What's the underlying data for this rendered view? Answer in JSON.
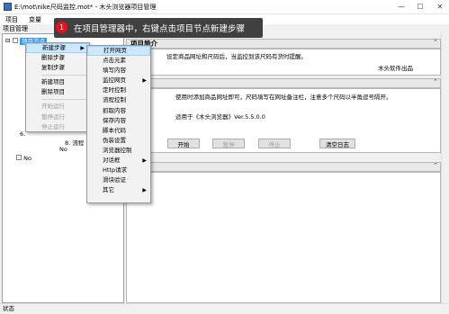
{
  "window": {
    "title": "E:\\mot\\nike尺码监控.mot* - 木头浏览器项目管理",
    "min_label": "—",
    "max_label": "☐",
    "close_label": "✕"
  },
  "menubar": [
    "项目",
    "变量"
  ],
  "tree": {
    "header": "项目管理",
    "root_label": "项目节点",
    "child_labels": [
      "6.",
      "8. 流程",
      "No"
    ],
    "bottom_label": "No"
  },
  "tooltip": {
    "number": "1",
    "text": "在项目管理器中，右键点击项目节点新建步骤"
  },
  "context_menu": {
    "items": [
      {
        "label": "新建步骤",
        "submenu": true,
        "disabled": false,
        "highlight": true
      },
      {
        "label": "删除步骤",
        "disabled": false
      },
      {
        "label": "复制步骤",
        "disabled": false
      },
      {
        "sep": true
      },
      {
        "label": "新建项目",
        "disabled": false
      },
      {
        "label": "删除项目",
        "disabled": false
      },
      {
        "sep": true
      },
      {
        "label": "开始运行",
        "disabled": true
      },
      {
        "label": "暂停运行",
        "disabled": true
      },
      {
        "label": "停止运行",
        "disabled": true
      }
    ]
  },
  "submenu": {
    "items": [
      {
        "label": "打开网页",
        "highlight": true
      },
      {
        "label": "点击元素"
      },
      {
        "label": "填写内容"
      },
      {
        "label": "监控网页",
        "submenu": true
      },
      {
        "label": "定时控制"
      },
      {
        "label": "流程控制"
      },
      {
        "label": "抓取内容"
      },
      {
        "label": "保存内容"
      },
      {
        "label": "脚本代码"
      },
      {
        "label": "伪装设置"
      },
      {
        "label": "浏览器控制"
      },
      {
        "label": "对话框",
        "submenu": true
      },
      {
        "label": "Http请求"
      },
      {
        "label": "滑块验证"
      },
      {
        "label": "其它",
        "submenu": true
      }
    ]
  },
  "project_intro": {
    "header": "项目简介",
    "text": "设定商品网址和尺码后，当监控到该尺码有货时提醒。",
    "author": "木头软件出品"
  },
  "project_desc": {
    "header": "说明",
    "text1": "使用时添加商品网址即可，尺码填写在网址备注栏，注意多个尺码以半角逗号隔开。",
    "text2": "适用于《木头浏览器》Ver.5.5.0.0"
  },
  "buttons": {
    "start": "开始",
    "pause": "暂停",
    "stop": "停止",
    "clear_log": "清空日志"
  },
  "log": {
    "header": "日志"
  },
  "collapse_symbols": {
    "up": "⌃"
  },
  "status": {
    "text": "状态"
  }
}
